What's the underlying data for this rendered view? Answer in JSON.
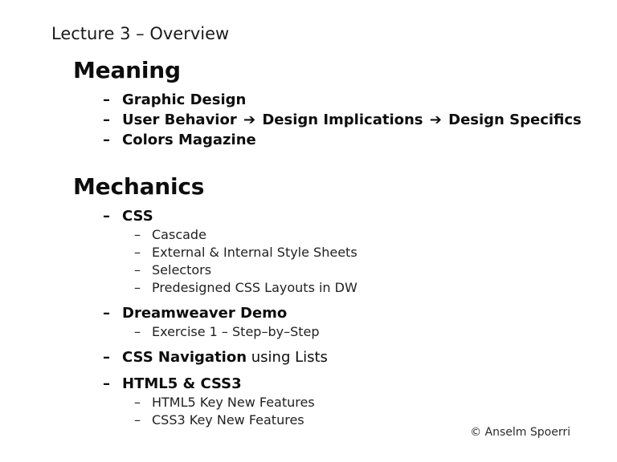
{
  "slide": {
    "title": "Lecture 3 – Overview",
    "background_color": "#ffffff",
    "text_color": "#111111",
    "footer": "© Anselm Spoerri"
  },
  "sections": [
    {
      "heading": "Meaning",
      "items": [
        {
          "level": 2,
          "dash": "–",
          "text": "Graphic Design"
        },
        {
          "level": 2,
          "dash": "–",
          "part1": "User Behavior ",
          "arrow1": "➔",
          "part2": " Design Implications ",
          "arrow2": "➔",
          "part3": " Design Specifics"
        },
        {
          "level": 2,
          "dash": "–",
          "text": "Colors Magazine"
        }
      ]
    },
    {
      "heading": "Mechanics",
      "items": [
        {
          "level": 2,
          "dash": "–",
          "text": "CSS"
        },
        {
          "level": 3,
          "dash": "–",
          "text": "Cascade"
        },
        {
          "level": 3,
          "dash": "–",
          "text": "External & Internal Style Sheets"
        },
        {
          "level": 3,
          "dash": "–",
          "text": "Selectors"
        },
        {
          "level": 3,
          "dash": "–",
          "text": "Predesigned CSS Layouts in DW"
        },
        {
          "level": 2,
          "dash": "–",
          "text": "Dreamweaver Demo"
        },
        {
          "level": 3,
          "dash": "–",
          "text": "Exercise 1 – Step–by–Step"
        },
        {
          "level": 2,
          "dash": "–",
          "bold": "CSS Navigation",
          "regular": " using Lists"
        },
        {
          "level": 2,
          "dash": "–",
          "text": "HTML5 & CSS3"
        },
        {
          "level": 3,
          "dash": "–",
          "text": "HTML5 Key New Features"
        },
        {
          "level": 3,
          "dash": "–",
          "text": "CSS3 Key New Features"
        }
      ]
    }
  ]
}
